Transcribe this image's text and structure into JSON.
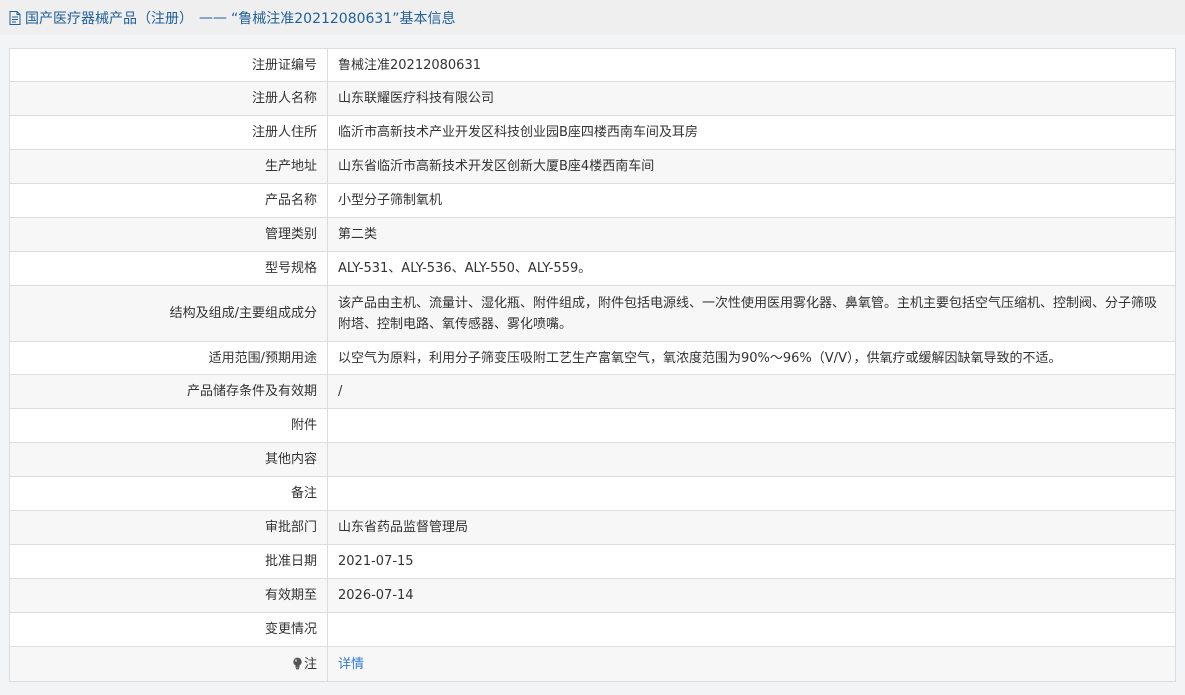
{
  "header": {
    "category": "国产医疗器械产品（注册）",
    "separator": "——",
    "title": "“鲁械注准20212080631”基本信息"
  },
  "rows": [
    {
      "label": "注册证编号",
      "value": "鲁械注准20212080631"
    },
    {
      "label": "注册人名称",
      "value": "山东联耀医疗科技有限公司"
    },
    {
      "label": "注册人住所",
      "value": "临沂市高新技术产业开发区科技创业园B座四楼西南车间及耳房"
    },
    {
      "label": "生产地址",
      "value": "山东省临沂市高新技术开发区创新大厦B座4楼西南车间"
    },
    {
      "label": "产品名称",
      "value": "小型分子筛制氧机"
    },
    {
      "label": "管理类别",
      "value": "第二类"
    },
    {
      "label": "型号规格",
      "value": "ALY-531、ALY-536、ALY-550、ALY-559。"
    },
    {
      "label": "结构及组成/主要组成成分",
      "value": "该产品由主机、流量计、湿化瓶、附件组成，附件包括电源线、一次性使用医用雾化器、鼻氧管。主机主要包括空气压缩机、控制阀、分子筛吸附塔、控制电路、氧传感器、雾化喷嘴。"
    },
    {
      "label": "适用范围/预期用途",
      "value": "以空气为原料，利用分子筛变压吸附工艺生产富氧空气，氧浓度范围为90%～96%（V/V），供氧疗或缓解因缺氧导致的不适。"
    },
    {
      "label": "产品储存条件及有效期",
      "value": "/"
    },
    {
      "label": "附件",
      "value": ""
    },
    {
      "label": "其他内容",
      "value": ""
    },
    {
      "label": "备注",
      "value": ""
    },
    {
      "label": "审批部门",
      "value": "山东省药品监督管理局"
    },
    {
      "label": "批准日期",
      "value": "2021-07-15"
    },
    {
      "label": "有效期至",
      "value": "2026-07-14"
    },
    {
      "label": "变更情况",
      "value": ""
    }
  ],
  "note_row": {
    "label": "注",
    "link": "详情",
    "icon": "bulb-icon"
  },
  "colors": {
    "header_text": "#1f5f9a",
    "link": "#2e7bd6",
    "border": "#dcdcdc"
  }
}
